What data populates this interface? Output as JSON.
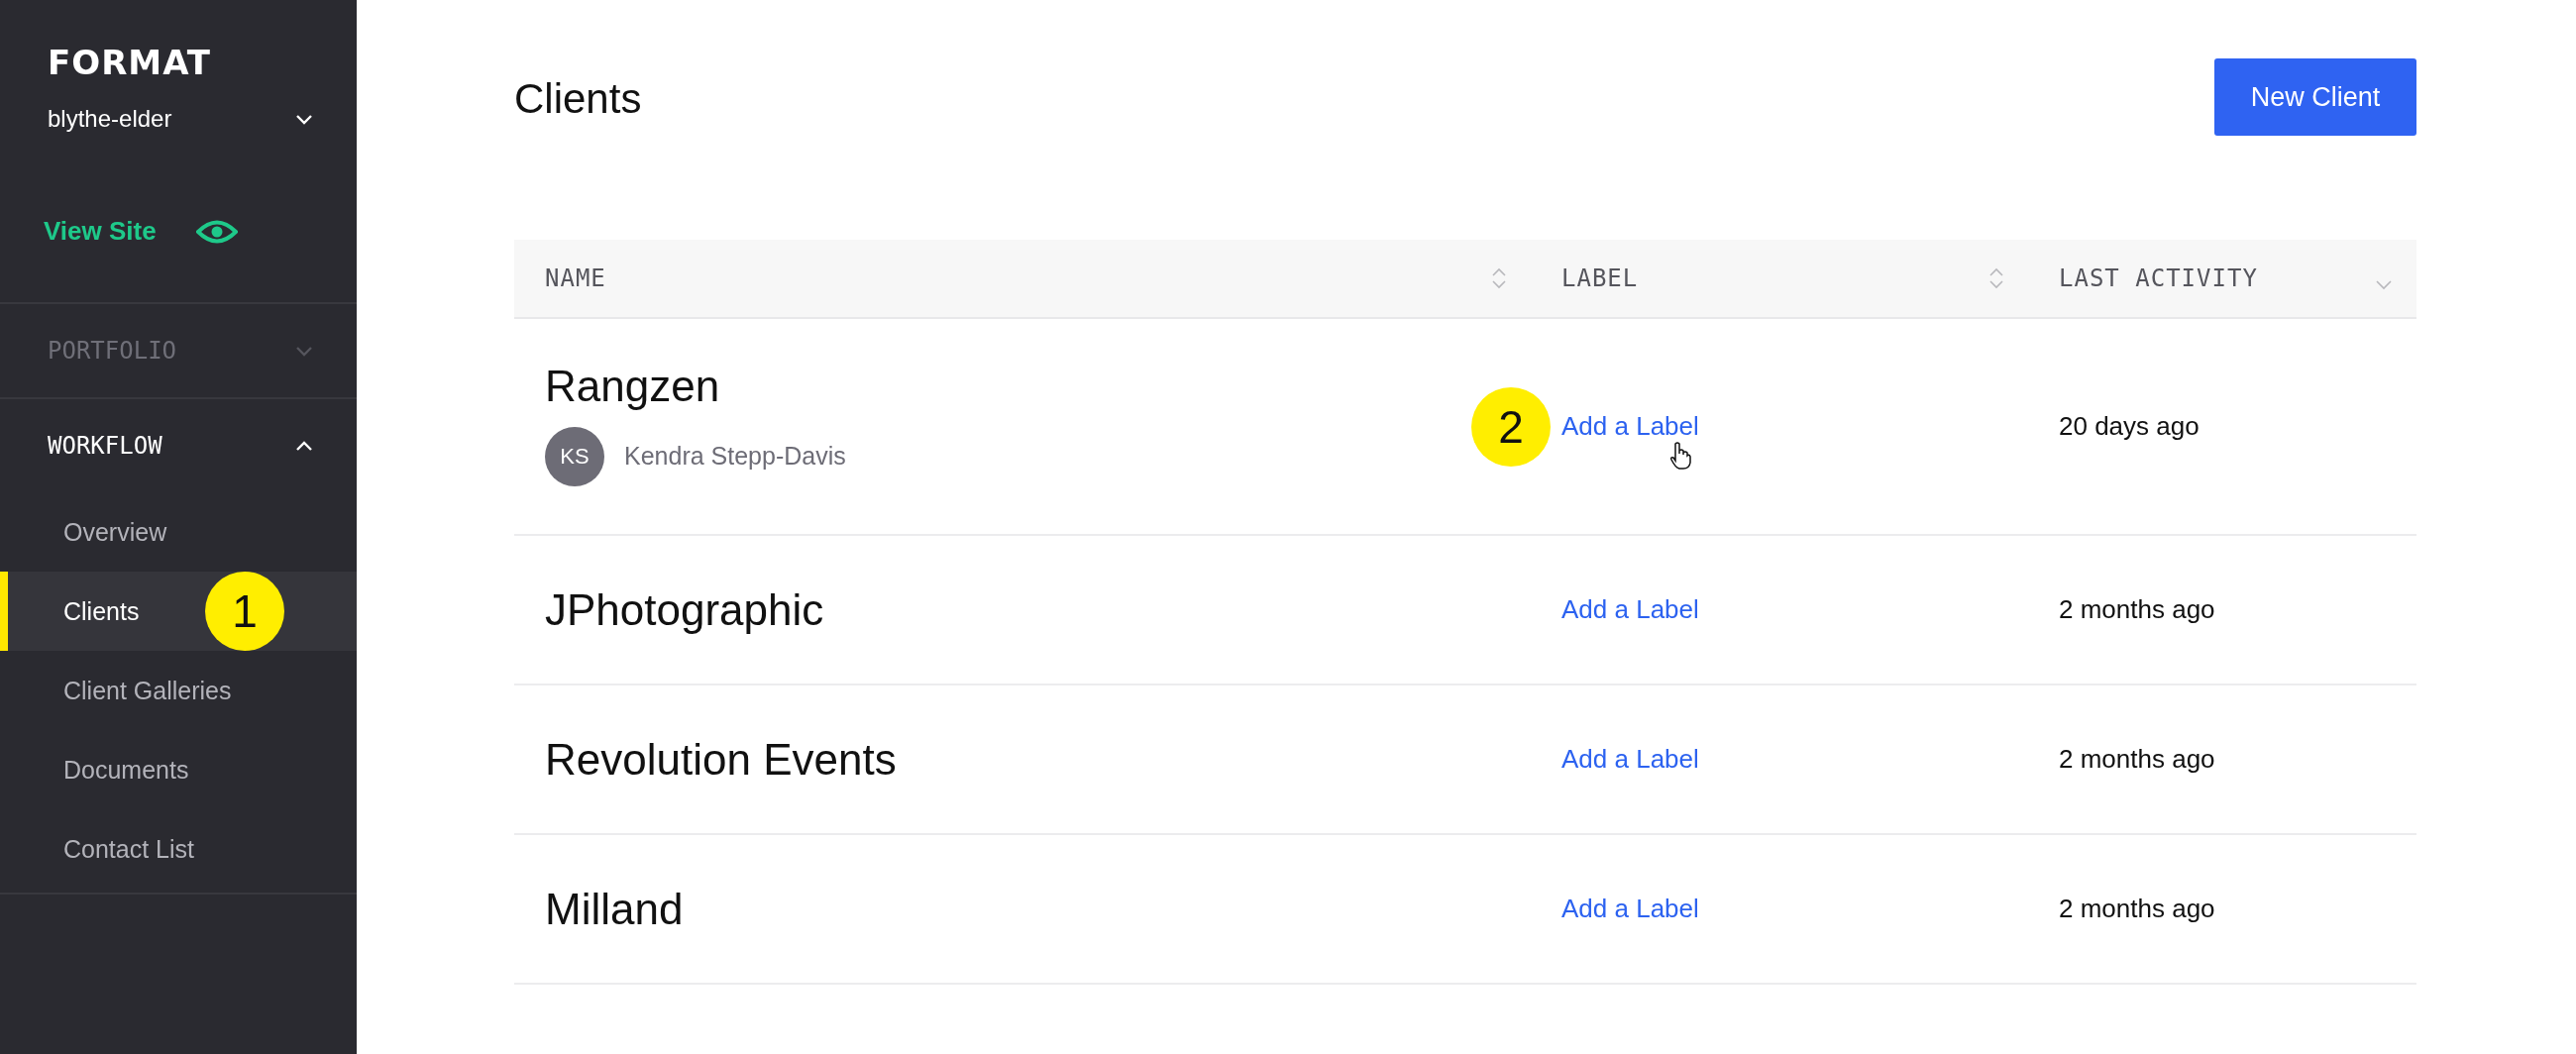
{
  "sidebar": {
    "logo": "FORMAT",
    "account": "blythe-elder",
    "view_site": "View Site",
    "sections": [
      {
        "title": "PORTFOLIO",
        "expanded": false
      },
      {
        "title": "WORKFLOW",
        "expanded": true,
        "items": [
          {
            "label": "Overview",
            "selected": false
          },
          {
            "label": "Clients",
            "selected": true,
            "badge": "1"
          },
          {
            "label": "Client Galleries",
            "selected": false
          },
          {
            "label": "Documents",
            "selected": false
          },
          {
            "label": "Contact List",
            "selected": false
          }
        ]
      }
    ]
  },
  "page": {
    "title": "Clients",
    "new_button": "New Client"
  },
  "table": {
    "columns": [
      {
        "label": "NAME",
        "sorted": false
      },
      {
        "label": "LABEL",
        "sorted": false
      },
      {
        "label": "LAST ACTIVITY",
        "sorted": true
      }
    ],
    "rows": [
      {
        "name": "Rangzen",
        "contact": {
          "initials": "KS",
          "name": "Kendra Stepp-Davis"
        },
        "label_link": "Add a Label",
        "badge": "2",
        "hovered": true,
        "activity": "20 days ago"
      },
      {
        "name": "JPhotographic",
        "label_link": "Add a Label",
        "hovered": false,
        "activity": "2 months ago"
      },
      {
        "name": "Revolution Events",
        "label_link": "Add a Label",
        "hovered": false,
        "activity": "2 months ago"
      },
      {
        "name": "Milland",
        "label_link": "Add a Label",
        "hovered": false,
        "activity": "2 months ago"
      }
    ]
  }
}
